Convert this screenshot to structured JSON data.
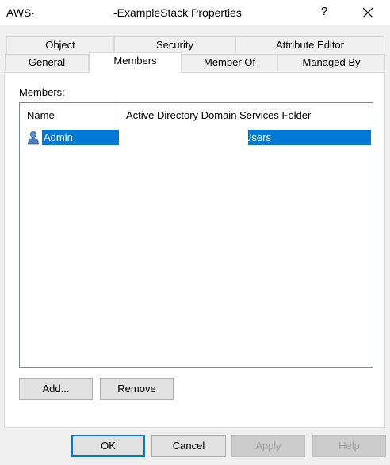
{
  "window": {
    "title_prefix": "AWS·",
    "title": "-ExampleStack Properties",
    "help_glyph": "?",
    "close_icon": "close-icon"
  },
  "tabs": {
    "row1": [
      "Object",
      "Security",
      "Attribute Editor"
    ],
    "row2": [
      "General",
      "Members",
      "Member Of",
      "Managed By"
    ],
    "active": "Members"
  },
  "members": {
    "label": "Members:",
    "columns": [
      "Name",
      "Active Directory Domain Services Folder"
    ],
    "rows": [
      {
        "name": "Admin",
        "folder": "Users",
        "icon": "user-icon",
        "selected": true
      }
    ],
    "add_label": "Add...",
    "remove_label": "Remove"
  },
  "footer": {
    "ok_label": "OK",
    "cancel_label": "Cancel",
    "apply_label": "Apply",
    "help_label": "Help"
  },
  "colors": {
    "selection": "#0078d7",
    "panel": "#ffffff",
    "dialog_bg": "#f0f0f0"
  }
}
